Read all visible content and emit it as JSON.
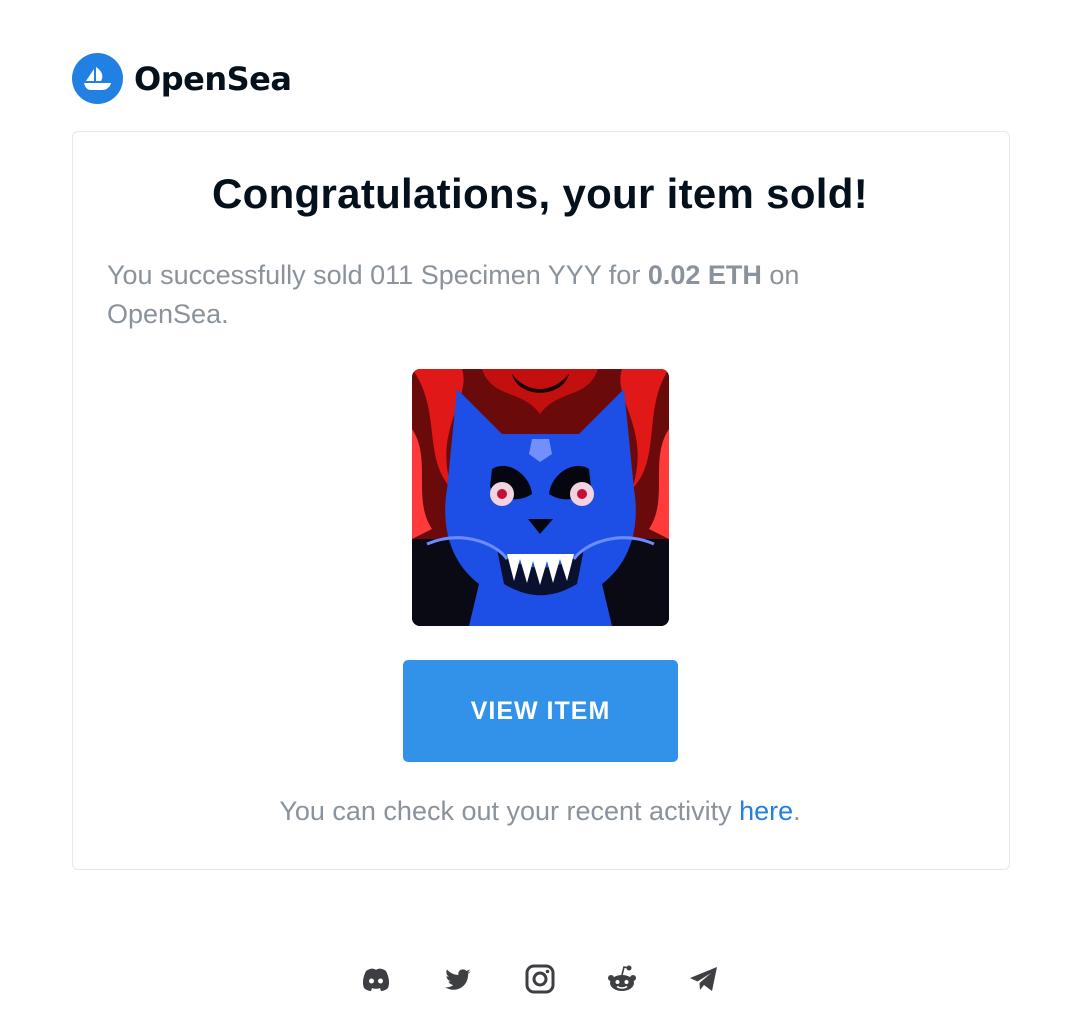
{
  "brand": {
    "name": "OpenSea"
  },
  "email": {
    "title": "Congratulations, your item sold!",
    "message_prefix": "You successfully sold 011 Specimen YYY for ",
    "price": "0.02 ETH",
    "message_suffix": " on OpenSea.",
    "view_button": "VIEW ITEM",
    "activity_prefix": "You can check out your recent activity ",
    "activity_link": "here",
    "activity_suffix": "."
  },
  "social": [
    "discord-icon",
    "twitter-icon",
    "instagram-icon",
    "reddit-icon",
    "telegram-icon"
  ],
  "colors": {
    "brand_blue": "#2081e2",
    "button_blue": "#3291e9",
    "text_gray": "#8a939b",
    "title": "#04111d"
  }
}
